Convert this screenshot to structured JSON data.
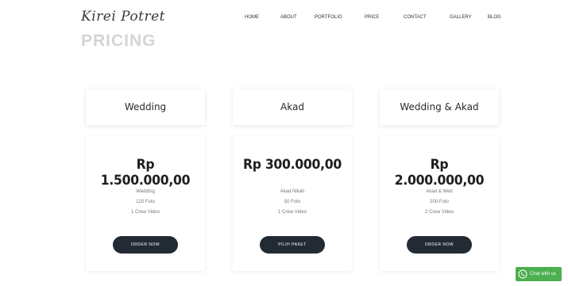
{
  "header": {
    "logo_text": "Kirei Potret",
    "nav": [
      "HOME",
      "ABOUT",
      "PORTFOLIO",
      "PRICE",
      "CONTACT",
      "GALLERY",
      "BLOG"
    ]
  },
  "section": {
    "title": "PRICING"
  },
  "plans": [
    {
      "name": "Wedding",
      "price": "Rp 1.500.000,00",
      "features": [
        "Wedding",
        "120 Foto",
        "1 Crew Video"
      ],
      "cta_label": "ORDER NOW"
    },
    {
      "name": "Akad",
      "price": "Rp 300.000,00",
      "features": [
        "Akad Nikah",
        "50 Foto",
        "1 Crew Video"
      ],
      "cta_label": "PILIH PAKET"
    },
    {
      "name": "Wedding & Akad",
      "price": "Rp 2.000.000,00",
      "features": [
        "Akad & Wed",
        "200 Foto",
        "2 Crew Video"
      ],
      "cta_label": "ORDER NOW"
    }
  ],
  "whatsapp": {
    "label": "Chat with us"
  },
  "colors": {
    "button": "#222a34",
    "whatsapp": "#4caf50"
  },
  "icons": {
    "whatsapp": "whatsapp-icon"
  }
}
